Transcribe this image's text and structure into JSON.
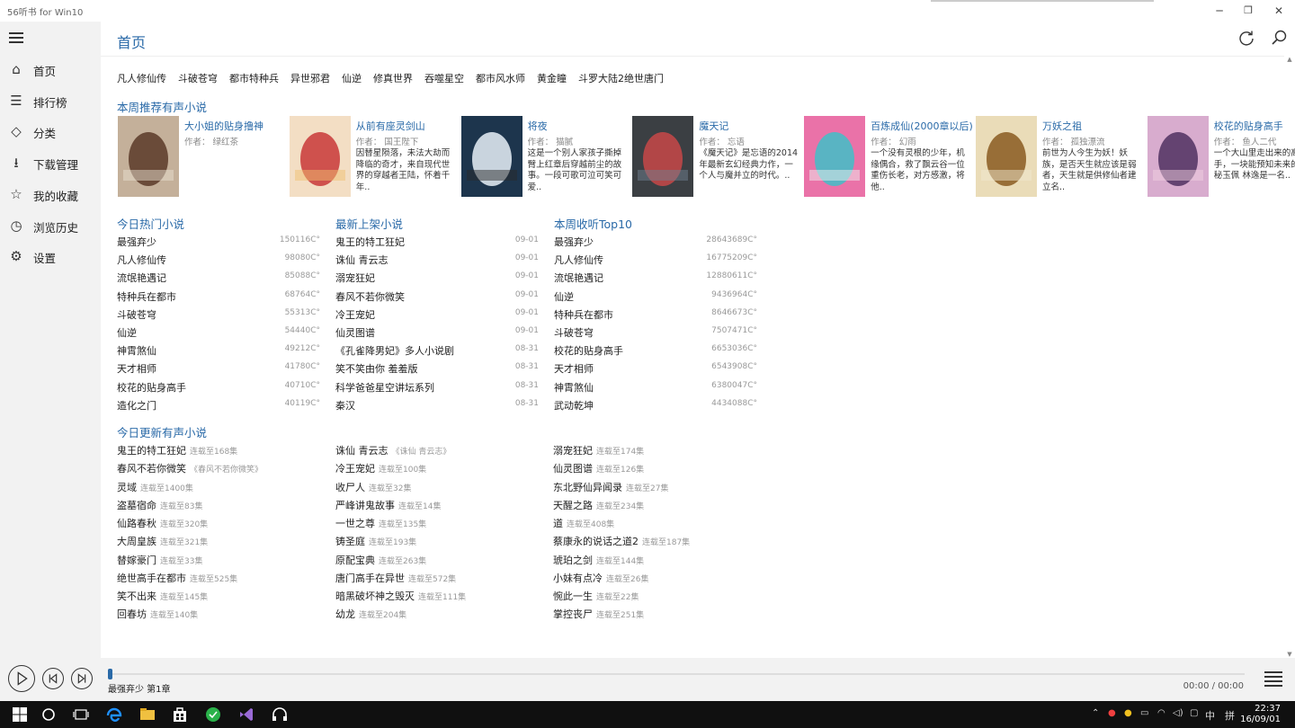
{
  "window": {
    "title": "56听书 for Win10",
    "minimize_glyph": "─",
    "maximize_glyph": "❐",
    "close_glyph": "✕"
  },
  "sidebar": {
    "items": [
      {
        "label": "首页",
        "icon": "home-icon",
        "glyph": "⌂"
      },
      {
        "label": "排行榜",
        "icon": "ranking-list-icon",
        "glyph": "☰"
      },
      {
        "label": "分类",
        "icon": "tag-icon",
        "glyph": "◇"
      },
      {
        "label": "下载管理",
        "icon": "download-icon",
        "glyph": "⭳"
      },
      {
        "label": "我的收藏",
        "icon": "star-icon",
        "glyph": "☆"
      },
      {
        "label": "浏览历史",
        "icon": "clock-icon",
        "glyph": "◷"
      },
      {
        "label": "设置",
        "icon": "gear-icon",
        "glyph": "⚙"
      }
    ]
  },
  "header": {
    "title": "首页"
  },
  "tags": [
    "凡人修仙传",
    "斗破苍穹",
    "都市特种兵",
    "异世邪君",
    "仙逆",
    "修真世界",
    "吞噬星空",
    "都市风水师",
    "黄金瞳",
    "斗罗大陆2绝世唐门"
  ],
  "recommend": {
    "title": "本周推荐有声小说",
    "books": [
      {
        "title": "大小姐的贴身撸神",
        "author": "作者： 绿红茶",
        "desc": "",
        "cover_colors": [
          "#b8a088",
          "#5a3a28",
          "#e8e0d0"
        ]
      },
      {
        "title": "从前有座灵剑山",
        "author": "作者： 国王陛下",
        "desc": "因替星陨落，未法大劫而降临的奇才，来自现代世界的穿越者王陆，怀着千年..",
        "cover_colors": [
          "#f4e8e0",
          "#c83838",
          "#f0c070"
        ]
      },
      {
        "title": "将夜",
        "author": "作者： 猫腻",
        "desc": "这是一个别人家孩子撕掉臂上红章后穿越前尘的故事。一段可歌可泣可笑可爱..",
        "cover_colors": [
          "#1a3a5a",
          "#e8f0f8",
          "#2a2a2a"
        ]
      },
      {
        "title": "魔天记",
        "author": "作者： 忘语",
        "desc": "《魔天记》是忘语的2014年最新玄幻经典力作，一个人与魔并立的时代。..",
        "cover_colors": [
          "#2a2a2a",
          "#c84848",
          "#708090"
        ]
      },
      {
        "title": "百炼成仙(2000章以后)",
        "author": "作者： 幻雨",
        "desc": "一个没有灵根的少年，机缘偶合，救了飘云谷一位重伤长老，对方感激，将他..",
        "cover_colors": [
          "#e84890",
          "#40c0c8",
          "#f0f0f0"
        ]
      },
      {
        "title": "万妖之祖",
        "author": "作者： 孤独漂流",
        "desc": "前世为人今生为妖！妖族，是否天生就应该是弱者，天生就是供修仙者建立名..",
        "cover_colors": [
          "#e8d8b0",
          "#8a5a20",
          "#f0e8d0"
        ]
      },
      {
        "title": "校花的贴身高手",
        "author": "作者： 鱼人二代",
        "desc": "一个大山里走出来的高手，一块能预知未来的神秘玉佩 林逸是一名..",
        "cover_colors": [
          "#d0a0c8",
          "#503060",
          "#f0d0e0"
        ]
      }
    ]
  },
  "hot_today": {
    "title": "今日热门小说",
    "rows": [
      {
        "name": "最强弃少",
        "value": "150116C°"
      },
      {
        "name": "凡人修仙传",
        "value": "98080C°"
      },
      {
        "name": "流氓艳遇记",
        "value": "85088C°"
      },
      {
        "name": "特种兵在都市",
        "value": "68764C°"
      },
      {
        "name": "斗破苍穹",
        "value": "55313C°"
      },
      {
        "name": "仙逆",
        "value": "54440C°"
      },
      {
        "name": "神霄煞仙",
        "value": "49212C°"
      },
      {
        "name": "天才相师",
        "value": "41780C°"
      },
      {
        "name": "校花的贴身高手",
        "value": "40710C°"
      },
      {
        "name": "造化之门",
        "value": "40119C°"
      }
    ]
  },
  "new_arrivals": {
    "title": "最新上架小说",
    "rows": [
      {
        "name": "鬼王的特工狂妃",
        "value": "09-01"
      },
      {
        "name": "诛仙 青云志",
        "value": "09-01"
      },
      {
        "name": "溺宠狂妃",
        "value": "09-01"
      },
      {
        "name": "春风不若你微笑",
        "value": "09-01"
      },
      {
        "name": "冷王宠妃",
        "value": "09-01"
      },
      {
        "name": "仙灵图谱",
        "value": "09-01"
      },
      {
        "name": "《孔雀降男妃》多人小说剧",
        "value": "08-31"
      },
      {
        "name": "笑不笑由你 羞羞版",
        "value": "08-31"
      },
      {
        "name": "科学爸爸星空讲坛系列",
        "value": "08-31"
      },
      {
        "name": "秦汉",
        "value": "08-31"
      }
    ]
  },
  "weekly_top": {
    "title": "本周收听Top10",
    "rows": [
      {
        "name": "最强弃少",
        "value": "28643689C°"
      },
      {
        "name": "凡人修仙传",
        "value": "16775209C°"
      },
      {
        "name": "流氓艳遇记",
        "value": "12880611C°"
      },
      {
        "name": "仙逆",
        "value": "9436964C°"
      },
      {
        "name": "特种兵在都市",
        "value": "8646673C°"
      },
      {
        "name": "斗破苍穹",
        "value": "7507471C°"
      },
      {
        "name": "校花的贴身高手",
        "value": "6653036C°"
      },
      {
        "name": "天才相师",
        "value": "6543908C°"
      },
      {
        "name": "神霄煞仙",
        "value": "6380047C°"
      },
      {
        "name": "武动乾坤",
        "value": "4434088C°"
      }
    ]
  },
  "updates": {
    "title": "今日更新有声小说",
    "columns": [
      [
        {
          "name": "鬼王的特工狂妃",
          "note": "连载至168集"
        },
        {
          "name": "春风不若你微笑",
          "note": "《春风不若你微笑》"
        },
        {
          "name": "灵域",
          "note": "连载至1400集"
        },
        {
          "name": "盗墓宿命",
          "note": "连载至83集"
        },
        {
          "name": "仙路春秋",
          "note": "连载至320集"
        },
        {
          "name": "大周皇族",
          "note": "连载至321集"
        },
        {
          "name": "替嫁豪门",
          "note": "连载至33集"
        },
        {
          "name": "绝世高手在都市",
          "note": "连载至525集"
        },
        {
          "name": "笑不出来",
          "note": "连载至145集"
        },
        {
          "name": "回春坊",
          "note": "连载至140集"
        }
      ],
      [
        {
          "name": "诛仙 青云志",
          "note": "《诛仙 青云志》"
        },
        {
          "name": "冷王宠妃",
          "note": "连载至100集"
        },
        {
          "name": "收尸人",
          "note": "连载至32集"
        },
        {
          "name": "严峰讲鬼故事",
          "note": "连载至14集"
        },
        {
          "name": "一世之尊",
          "note": "连载至135集"
        },
        {
          "name": "铸圣庭",
          "note": "连载至193集"
        },
        {
          "name": "原配宝典",
          "note": "连载至263集"
        },
        {
          "name": "唐门高手在异世",
          "note": "连载至572集"
        },
        {
          "name": "暗黑破坏神之毁灭",
          "note": "连载至111集"
        },
        {
          "name": "幼龙",
          "note": "连载至204集"
        }
      ],
      [
        {
          "name": "溺宠狂妃",
          "note": "连载至174集"
        },
        {
          "name": "仙灵图谱",
          "note": "连载至126集"
        },
        {
          "name": "东北野仙异闻录",
          "note": "连载至27集"
        },
        {
          "name": "天醒之路",
          "note": "连载至234集"
        },
        {
          "name": "道",
          "note": "连载至408集"
        },
        {
          "name": "蔡康永的说话之道2",
          "note": "连载至187集"
        },
        {
          "name": "琥珀之剑",
          "note": "连载至144集"
        },
        {
          "name": "小妹有点冷",
          "note": "连载至26集"
        },
        {
          "name": "惋此一生",
          "note": "连载至22集"
        },
        {
          "name": "掌控丧尸",
          "note": "连载至251集"
        }
      ]
    ]
  },
  "player": {
    "now_playing": "最强弃少 第1章",
    "time": "00:00 / 00:00",
    "progress": 0
  },
  "taskbar": {
    "tray_lang": "中",
    "tray_ime": "拼",
    "clock_time": "22:37",
    "clock_date": "16/09/01"
  }
}
